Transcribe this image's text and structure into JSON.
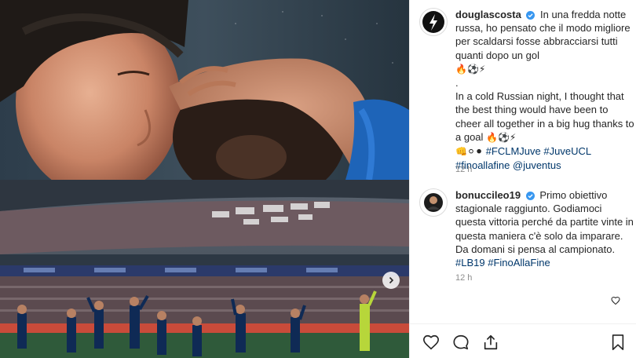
{
  "post": {
    "next_icon": "chevron-right-icon"
  },
  "comments": [
    {
      "username": "douglascosta",
      "verified": true,
      "text_it": "In una fredda notte russa, ho pensato che il modo migliore per scaldarsi fosse abbracciarsi tutti quanti dopo un gol",
      "emoji_it": "🔥⚽⚡",
      "separator": ".",
      "text_en": "In a cold Russian night, I thought that the best thing would have been to cheer all together in a big hug thanks to a goal",
      "emoji_en": "🔥⚽⚡",
      "emoji_badges": "👊⚪⚫",
      "hashtags": [
        "#FCLMJuve",
        "#JuveUCL",
        "#finoallafine"
      ],
      "mention": "@juventus",
      "time": "12 h"
    },
    {
      "username": "bonuccileo19",
      "verified": true,
      "text": "Primo obiettivo stagionale raggiunto. Godiamoci questa vittoria perché da partite vinte in questa maniera c'è solo da imparare. Da domani si pensa al campionato.",
      "hashtags": [
        "#LB19",
        "#FinoAllaFine"
      ],
      "time": "12 h"
    }
  ],
  "actions": {
    "like_icon": "heart-icon",
    "comment_icon": "comment-icon",
    "share_icon": "share-icon",
    "save_icon": "bookmark-icon"
  },
  "colors": {
    "hashtag": "#00376b",
    "verified": "#3897f0",
    "timestamp": "#8e8e8e"
  }
}
